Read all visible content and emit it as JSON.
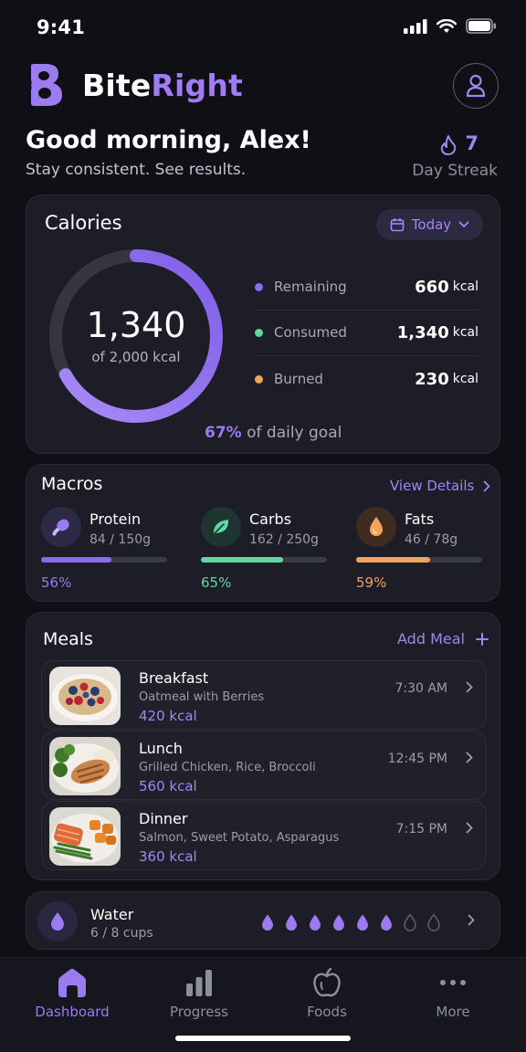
{
  "status_bar": {
    "time": "9:41"
  },
  "header": {
    "brand_part1": "Bite",
    "brand_part2": "Right",
    "profile_icon": "user-icon"
  },
  "greeting": {
    "title": "Good morning, Alex!",
    "subtitle": "Stay consistent. See results."
  },
  "streak": {
    "value": "7",
    "label": "Day Streak",
    "icon": "flame-icon"
  },
  "calories": {
    "title": "Calories",
    "period": "Today",
    "consumed_display": "1,340",
    "goal_display": "of 2,000 kcal",
    "goal_fraction": 0.67,
    "goal_percent": "67%",
    "goal_suffix": "of daily goal",
    "rows": [
      {
        "label": "Remaining",
        "value": "660",
        "unit": "kcal",
        "color": "#8b6cf0"
      },
      {
        "label": "Consumed",
        "value": "1,340",
        "unit": "kcal",
        "color": "#5fd8a2"
      },
      {
        "label": "Burned",
        "value": "230",
        "unit": "kcal",
        "color": "#f3a35a"
      }
    ]
  },
  "macros": {
    "title": "Macros",
    "view_details": "View Details",
    "items": [
      {
        "name": "Protein",
        "amount": "84 / 150g",
        "percent": "56%",
        "fraction": 0.56,
        "color": "#8b6cf0",
        "icon": "drumstick-icon"
      },
      {
        "name": "Carbs",
        "amount": "162 / 250g",
        "percent": "65%",
        "fraction": 0.65,
        "color": "#5fd8a2",
        "icon": "leaf-icon"
      },
      {
        "name": "Fats",
        "amount": "46 / 78g",
        "percent": "59%",
        "fraction": 0.59,
        "color": "#f3a35a",
        "icon": "drop-icon"
      }
    ]
  },
  "meals": {
    "title": "Meals",
    "add_label": "Add Meal",
    "items": [
      {
        "name": "Breakfast",
        "desc": "Oatmeal with Berries",
        "kcal": "420 kcal",
        "time": "7:30 AM"
      },
      {
        "name": "Lunch",
        "desc": "Grilled Chicken, Rice, Broccoli",
        "kcal": "560 kcal",
        "time": "12:45 PM"
      },
      {
        "name": "Dinner",
        "desc": "Salmon, Sweet Potato, Asparagus",
        "kcal": "360 kcal",
        "time": "7:15 PM"
      }
    ]
  },
  "water": {
    "title": "Water",
    "amount": "6 / 8 cups",
    "filled": 6,
    "total": 8
  },
  "tabs": [
    {
      "label": "Dashboard",
      "icon": "home-icon",
      "active": true
    },
    {
      "label": "Progress",
      "icon": "bar-chart-icon",
      "active": false
    },
    {
      "label": "Foods",
      "icon": "apple-icon",
      "active": false
    },
    {
      "label": "More",
      "icon": "more-dots-icon",
      "active": false
    }
  ],
  "colors": {
    "accent": "#9b7bf0",
    "background": "#0f1016",
    "card": "#1c1d26"
  }
}
